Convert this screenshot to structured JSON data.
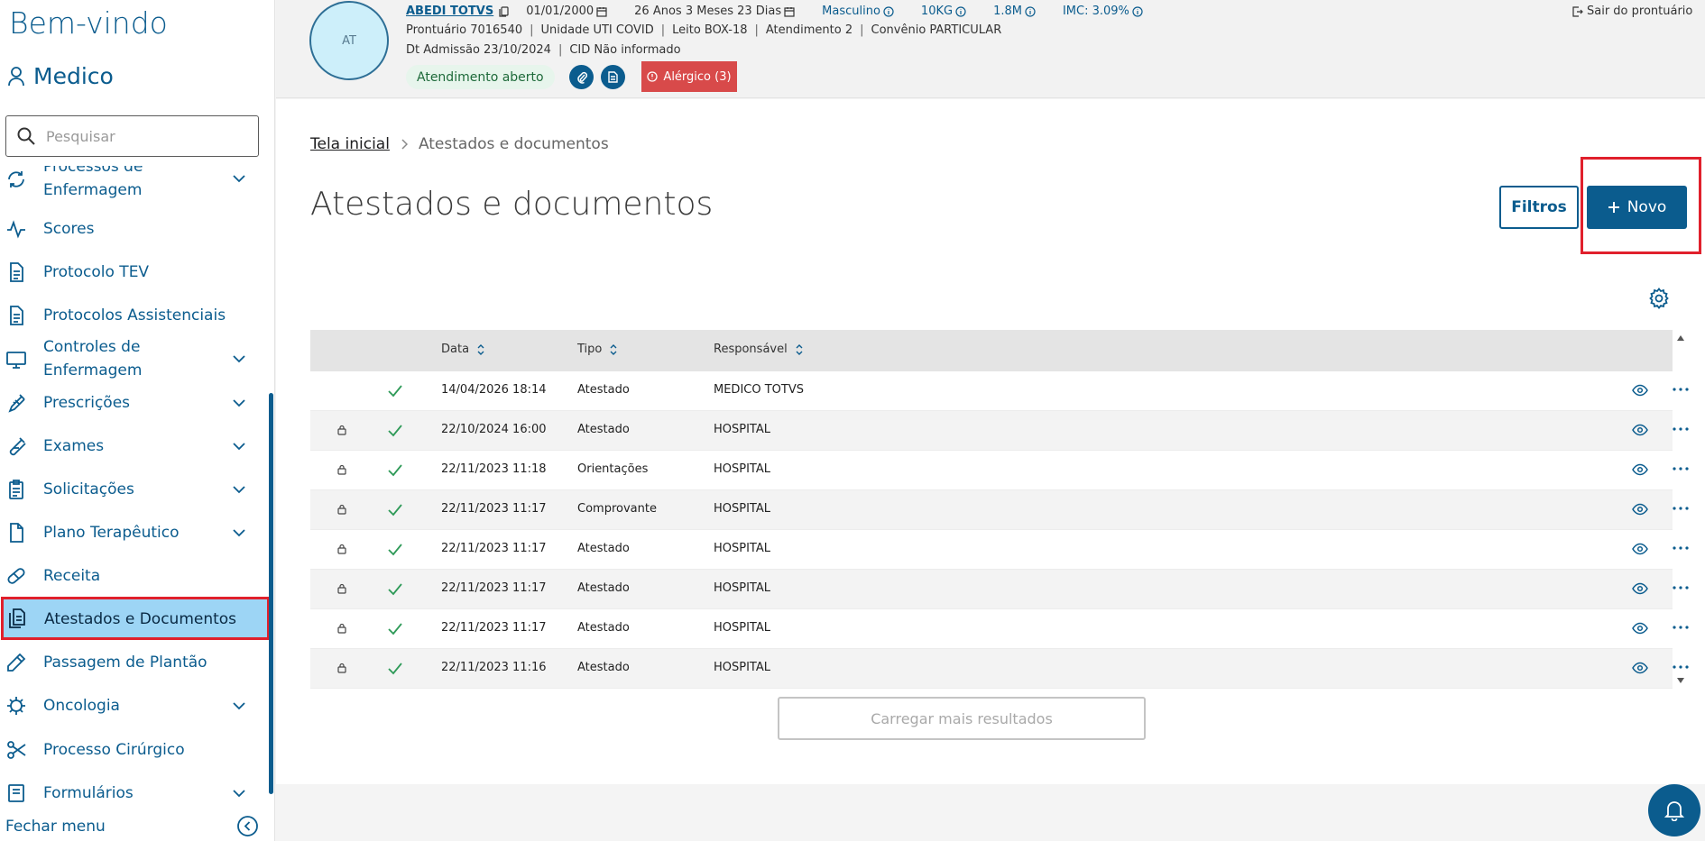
{
  "sidebar": {
    "welcome": "Bem-vindo",
    "user": "Medico",
    "search_placeholder": "Pesquisar",
    "items": [
      {
        "label_line1": "Processos de",
        "label_line2": "Enfermagem",
        "icon": "refresh-icon",
        "expandable": true
      },
      {
        "label": "Scores",
        "icon": "activity-icon",
        "expandable": false
      },
      {
        "label": "Protocolo TEV",
        "icon": "document-icon",
        "expandable": false
      },
      {
        "label": "Protocolos Assistenciais",
        "icon": "document-icon",
        "expandable": false
      },
      {
        "label_line1": "Controles de",
        "label_line2": "Enfermagem",
        "icon": "monitor-icon",
        "expandable": true
      },
      {
        "label": "Prescrições",
        "icon": "syringe-icon",
        "expandable": true
      },
      {
        "label": "Exames",
        "icon": "test-tube-icon",
        "expandable": true
      },
      {
        "label": "Solicitações",
        "icon": "clipboard-icon",
        "expandable": true
      },
      {
        "label": "Plano Terapêutico",
        "icon": "file-icon",
        "expandable": true
      },
      {
        "label": "Receita",
        "icon": "pill-icon",
        "expandable": false
      },
      {
        "label": "Atestados e Documentos",
        "icon": "documents-icon",
        "expandable": false,
        "active": true
      },
      {
        "label": "Passagem de Plantão",
        "icon": "pencil-icon",
        "expandable": false
      },
      {
        "label": "Oncologia",
        "icon": "virus-icon",
        "expandable": true
      },
      {
        "label": "Processo Cirúrgico",
        "icon": "scissors-icon",
        "expandable": false
      },
      {
        "label": "Formulários",
        "icon": "form-icon",
        "expandable": true
      }
    ],
    "footer_label": "Fechar menu"
  },
  "patient": {
    "initials": "AT",
    "name": "ABEDI TOTVS",
    "birth": "01/01/2000",
    "age": "26 Anos 3 Meses 23 Dias",
    "sex": "Masculino",
    "weight": "10KG",
    "height": "1.8M",
    "imc": "IMC: 3.09%",
    "prontuario": "Prontuário 7016540",
    "unidade": "Unidade UTI COVID",
    "leito": "Leito BOX-18",
    "atendimento": "Atendimento 2",
    "convenio": "Convênio PARTICULAR",
    "admissao": "Dt Admissão 23/10/2024",
    "cid": "CID Não informado",
    "status": "Atendimento aberto",
    "allergy": "Alérgico (3)",
    "exit": "Sair do prontuário"
  },
  "main": {
    "breadcrumb_home": "Tela inicial",
    "breadcrumb_current": "Atestados e documentos",
    "title": "Atestados e documentos",
    "filter_label": "Filtros",
    "new_label": "Novo",
    "load_more": "Carregar mais resultados"
  },
  "table": {
    "headers": {
      "date": "Data",
      "type": "Tipo",
      "responsible": "Responsável"
    },
    "rows": [
      {
        "locked": false,
        "date": "14/04/2026 18:14",
        "type": "Atestado",
        "responsible": "MEDICO TOTVS"
      },
      {
        "locked": true,
        "date": "22/10/2024 16:00",
        "type": "Atestado",
        "responsible": "HOSPITAL"
      },
      {
        "locked": true,
        "date": "22/11/2023 11:18",
        "type": "Orientações",
        "responsible": "HOSPITAL"
      },
      {
        "locked": true,
        "date": "22/11/2023 11:17",
        "type": "Comprovante",
        "responsible": "HOSPITAL"
      },
      {
        "locked": true,
        "date": "22/11/2023 11:17",
        "type": "Atestado",
        "responsible": "HOSPITAL"
      },
      {
        "locked": true,
        "date": "22/11/2023 11:17",
        "type": "Atestado",
        "responsible": "HOSPITAL"
      },
      {
        "locked": true,
        "date": "22/11/2023 11:17",
        "type": "Atestado",
        "responsible": "HOSPITAL"
      },
      {
        "locked": true,
        "date": "22/11/2023 11:16",
        "type": "Atestado",
        "responsible": "HOSPITAL"
      }
    ]
  },
  "colors": {
    "brand": "#0b5c8e",
    "active_bg": "#9dd5f5",
    "highlight": "#e0202c",
    "allergy": "#d84a4a",
    "success": "#2e9a58"
  }
}
